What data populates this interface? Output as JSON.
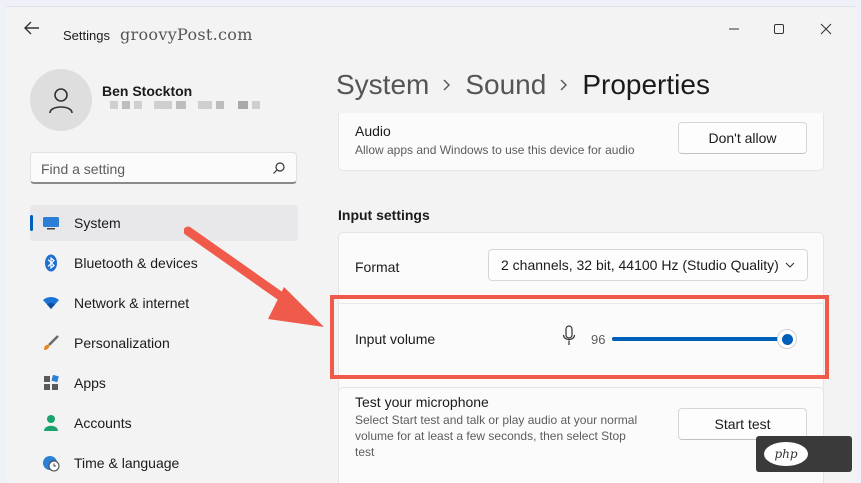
{
  "window": {
    "title": "Settings",
    "watermark": "groovyPost.com"
  },
  "user": {
    "name": "Ben Stockton",
    "email_redacted": true
  },
  "search": {
    "placeholder": "Find a setting"
  },
  "sidebar": {
    "items": [
      {
        "label": "System",
        "icon": "monitor-icon",
        "active": true
      },
      {
        "label": "Bluetooth & devices",
        "icon": "bluetooth-icon",
        "active": false
      },
      {
        "label": "Network & internet",
        "icon": "wifi-icon",
        "active": false
      },
      {
        "label": "Personalization",
        "icon": "brush-icon",
        "active": false
      },
      {
        "label": "Apps",
        "icon": "apps-icon",
        "active": false
      },
      {
        "label": "Accounts",
        "icon": "person-icon",
        "active": false
      },
      {
        "label": "Time & language",
        "icon": "globe-clock-icon",
        "active": false
      }
    ]
  },
  "breadcrumb": [
    "System",
    "Sound",
    "Properties"
  ],
  "audio_card": {
    "title": "Audio",
    "description": "Allow apps and Windows to use this device for audio",
    "button": "Don't allow"
  },
  "input_settings": {
    "section_label": "Input settings",
    "format": {
      "label": "Format",
      "value": "2 channels, 32 bit, 44100 Hz (Studio Quality)"
    },
    "input_volume": {
      "label": "Input volume",
      "value": 96,
      "value_text": "96"
    },
    "test_mic": {
      "title": "Test your microphone",
      "description_lines": [
        "Select Start test and talk or play audio at your normal",
        "volume for at least a few seconds, then select Stop",
        "test"
      ],
      "button": "Start test"
    }
  },
  "badge": {
    "text": "php"
  },
  "colors": {
    "accent": "#005fb8",
    "highlight_border": "#f05a4a",
    "arrow": "#f05a4a"
  }
}
